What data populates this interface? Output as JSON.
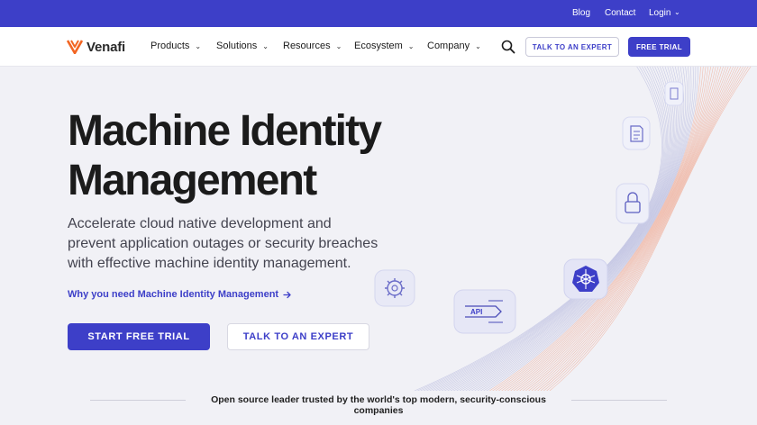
{
  "topbar": {
    "links": [
      "Blog",
      "Contact",
      "Login"
    ]
  },
  "nav": {
    "brand": "Venafi",
    "items": [
      "Products",
      "Solutions",
      "Resources",
      "Ecosystem",
      "Company"
    ],
    "talk_label": "TALK TO AN EXPERT",
    "trial_label": "FREE TRIAL"
  },
  "hero": {
    "title_line1": "Machine Identity",
    "title_line2": "Management",
    "subtitle": "Accelerate cloud native development and prevent application outages or security breaches with effective machine identity management.",
    "link": "Why you need Machine Identity Management",
    "primary_cta": "START FREE TRIAL",
    "secondary_cta": "TALK TO AN EXPERT",
    "api_label": "API"
  },
  "trust": {
    "text": "Open source leader trusted by the world's top modern, security-conscious companies"
  },
  "colors": {
    "brand": "#3d3fc8",
    "logo_orange": "#f26522",
    "background": "#f1f1f6"
  },
  "icons": [
    "search-icon",
    "venafi-logo-icon",
    "arrow-right-icon",
    "chevron-down-icon",
    "gear-icon",
    "kubernetes-icon",
    "api-icon",
    "document-icon",
    "lock-icon"
  ]
}
